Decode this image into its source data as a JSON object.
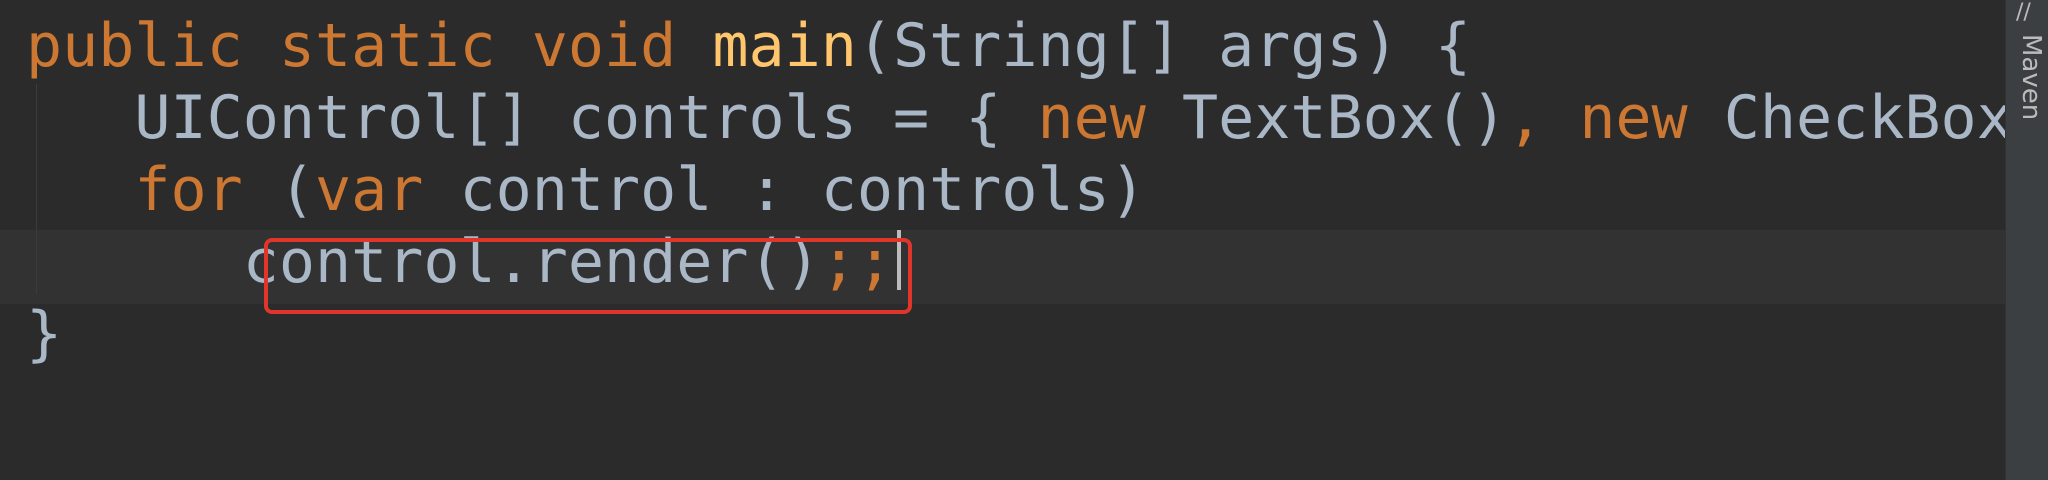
{
  "editor": {
    "lines": [
      {
        "tokens": [
          {
            "text": "public static void ",
            "cls": "kw"
          },
          {
            "text": "main",
            "cls": "fn"
          },
          {
            "text": "(String[] args) {",
            "cls": "plain"
          }
        ]
      },
      {
        "tokens": [
          {
            "text": "   UIControl[] controls = { ",
            "cls": "plain"
          },
          {
            "text": "new",
            "cls": "kw"
          },
          {
            "text": " TextBox()",
            "cls": "plain"
          },
          {
            "text": ",",
            "cls": "punc"
          },
          {
            "text": " ",
            "cls": "plain"
          },
          {
            "text": "new",
            "cls": "kw"
          },
          {
            "text": " CheckBox",
            "cls": "plain"
          }
        ]
      },
      {
        "tokens": [
          {
            "text": "   ",
            "cls": "plain"
          },
          {
            "text": "for",
            "cls": "kw"
          },
          {
            "text": " (",
            "cls": "plain"
          },
          {
            "text": "var",
            "cls": "kw"
          },
          {
            "text": " control : controls)",
            "cls": "plain"
          }
        ]
      },
      {
        "tokens": [
          {
            "text": "      control.render()",
            "cls": "plain"
          },
          {
            "text": ";;",
            "cls": "punc"
          }
        ],
        "has_caret": true
      },
      {
        "tokens": [
          {
            "text": "}",
            "cls": "plain"
          }
        ]
      }
    ]
  },
  "side_panel": {
    "tool_window_label": "Maven",
    "tool_window_icon": "maven-icon",
    "icon_glyph": "//"
  },
  "colors": {
    "background": "#2b2b2b",
    "keyword": "#cc7832",
    "function": "#ffc66d",
    "text": "#a9b7c6",
    "highlight_box": "#e0352b"
  }
}
